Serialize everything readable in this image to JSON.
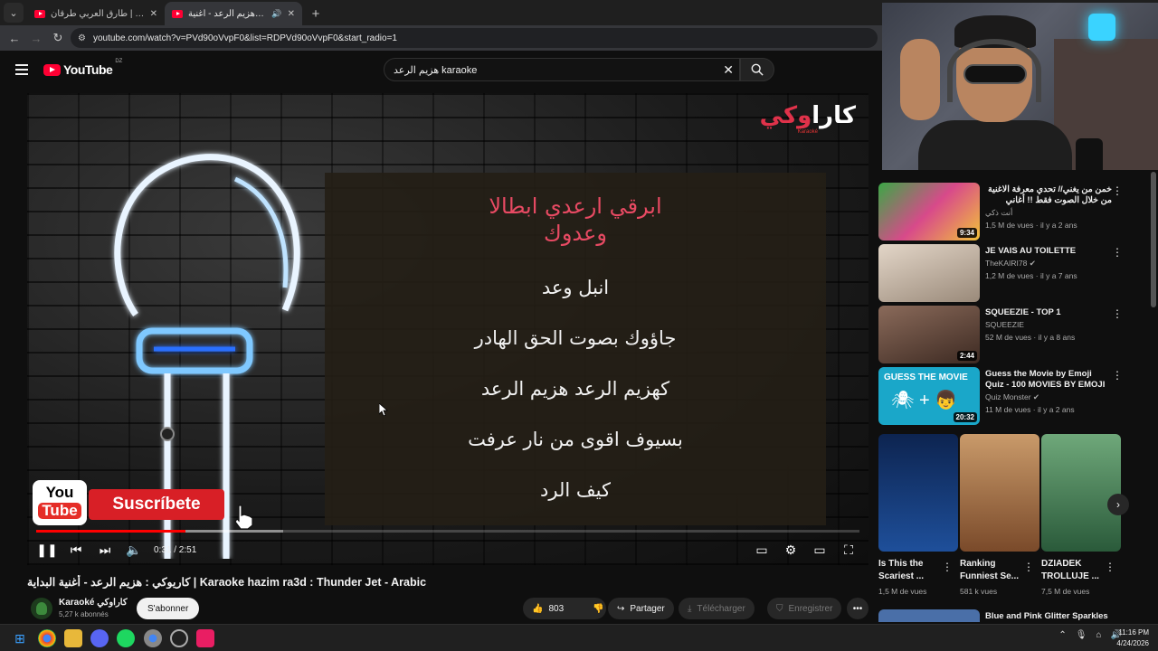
{
  "browser": {
    "tabs": [
      {
        "title": "هزيم الرعد | طارق العربي طرقان",
        "active": false
      },
      {
        "title": "كاريوكي : هزيم الرعد - أغنية",
        "active": true
      }
    ],
    "url": "youtube.com/watch?v=PVd90oVvpF0&list=RDPVd90oVvpF0&start_radio=1"
  },
  "masthead": {
    "logo_text": "YouTube",
    "country_code": "DZ",
    "search_value": "هزيم الرعد karaoke"
  },
  "player": {
    "brand_ar_white": "كارا",
    "brand_ar_red": "وكي",
    "brand_latin": "Karaoké",
    "lyrics": [
      {
        "text": "ابرقي ارعدي ابطالا",
        "highlight": true
      },
      {
        "text": "وعدوك",
        "highlight": true
      },
      {
        "text": "انبل وعد",
        "highlight": false
      },
      {
        "text": "جاؤوك بصوت الحق الهادر",
        "highlight": false
      },
      {
        "text": "كهزيم الرعد هزيم الرعد",
        "highlight": false
      },
      {
        "text": "بسيوف اقوى من نار عرفت",
        "highlight": false
      },
      {
        "text": "كيف الرد",
        "highlight": false
      }
    ],
    "subscribe_overlay": {
      "badge_top": "You",
      "badge_bottom": "Tube",
      "label": "Suscríbete"
    },
    "time_display": "0:31 / 2:51",
    "progress_played": 0.181,
    "progress_loaded": 0.3
  },
  "video": {
    "title": "كاريوكي : هزيم الرعد - أغنية البداية | Karaoke hazim ra3d : Thunder Jet - Arabic",
    "channel_name": "Karaoké كاراوكي",
    "subscribers": "5,27 k abonnés",
    "subscribe_label": "S'abonner",
    "likes": "803",
    "share_label": "Partager",
    "download_label": "Télécharger",
    "save_label": "Enregistrer"
  },
  "recommendations": [
    {
      "title": "خمن من يغني// تحدي معرفة الاغنية من خلال الصوت فقط !! أغاني",
      "channel": "أنت ذكي",
      "meta": "1,5 M de vues · il y a 2 ans",
      "duration": "9:34",
      "thumb_color": "#2a8a3a"
    },
    {
      "title": "JE VAIS AU TOILETTE",
      "channel": "TheKAIRI78",
      "meta": "1,2 M de vues · il y a 7 ans",
      "duration": "",
      "thumb_color": "#c8b8a8",
      "verified": true
    },
    {
      "title": "SQUEEZIE - TOP 1",
      "channel": "SQUEEZIE",
      "meta": "52 M de vues · il y a 8 ans",
      "duration": "2:44",
      "thumb_color": "#6b4a3a"
    },
    {
      "title": "Guess the Movie by Emoji Quiz - 100 MOVIES BY EMOJI",
      "channel": "Quiz Monster",
      "meta": "11 M de vues · il y a 2 ans",
      "duration": "20:32",
      "thumb_color": "#1aa7c9",
      "verified": true,
      "thumb_label": "GUESS THE MOVIE"
    }
  ],
  "shorts": [
    {
      "title": "Is This the Scariest ...",
      "views": "1,5 M de vues",
      "color": "#1e3f7a"
    },
    {
      "title": "Ranking Funniest Se...",
      "views": "581 k vues",
      "color": "#9a6a4a"
    },
    {
      "title": "DZIADEK TROLLUJE ...",
      "views": "7,5 M de vues",
      "color": "#4f8a5a"
    }
  ],
  "last_recommendation": {
    "title": "Blue and Pink Glitter Sparkles"
  },
  "taskbar": {
    "time": "11:16 PM",
    "date": "4/24/2026"
  }
}
